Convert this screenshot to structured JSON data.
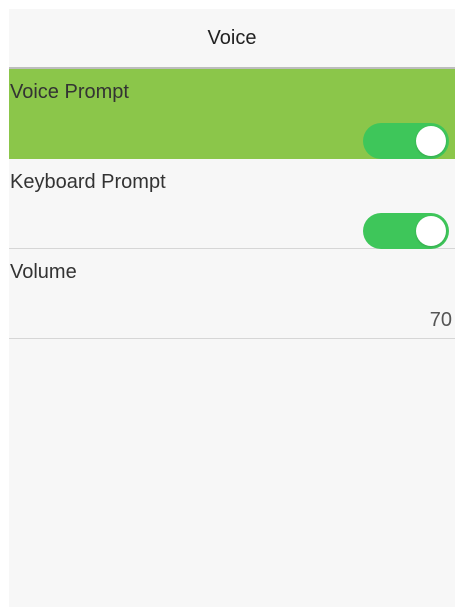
{
  "header": {
    "title": "Voice"
  },
  "items": [
    {
      "label": "Voice Prompt",
      "control": "toggle",
      "state": "on",
      "selected": true
    },
    {
      "label": "Keyboard Prompt",
      "control": "toggle",
      "state": "on",
      "selected": false
    },
    {
      "label": "Volume",
      "control": "value",
      "value": "70",
      "selected": false
    }
  ],
  "colors": {
    "selected_row": "#8bc64a",
    "toggle_on": "#3ec65a",
    "background": "#f7f7f7"
  }
}
